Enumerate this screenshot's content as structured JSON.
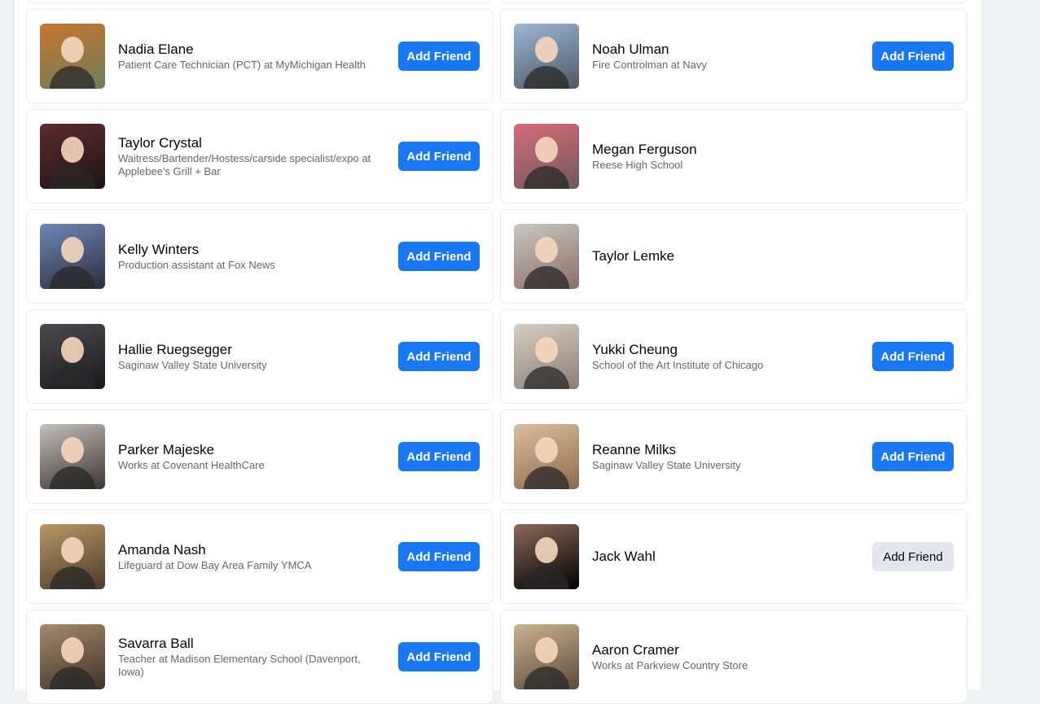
{
  "colors": {
    "primary_button": "#1877f2",
    "secondary_button": "#e4e6eb",
    "page_bg": "#f0f2f5"
  },
  "cards": [
    {
      "name": "",
      "subtitle": "",
      "button": "",
      "photo": [
        "#c9a38a",
        "#7a5a48"
      ]
    },
    {
      "name": "",
      "subtitle": "",
      "button": "",
      "photo": [
        "#b8c2c8",
        "#6b7377"
      ]
    },
    {
      "name": "Nadia Elane",
      "subtitle": "Patient Care Technician (PCT) at MyMichigan Health",
      "button": "Add Friend",
      "photo": [
        "#c9752e",
        "#6d7d5a"
      ]
    },
    {
      "name": "Noah Ulman",
      "subtitle": "Fire Controlman at Navy",
      "button": "Add Friend",
      "photo": [
        "#9bb8d6",
        "#4d5963"
      ]
    },
    {
      "name": "Taylor Crystal",
      "subtitle": "Waitress/Bartender/Hostess/carside specialist/expo at Applebee's Grill + Bar",
      "button": "Add Friend",
      "photo": [
        "#5e2b2e",
        "#1d1414"
      ]
    },
    {
      "name": "Megan Ferguson",
      "subtitle": "Reese High School",
      "button": "",
      "photo": [
        "#d86b7a",
        "#6e5a5a"
      ]
    },
    {
      "name": "Kelly Winters",
      "subtitle": "Production assistant at Fox News",
      "button": "Add Friend",
      "photo": [
        "#6f88b8",
        "#2b2d3a"
      ]
    },
    {
      "name": "Taylor Lemke",
      "subtitle": "",
      "button": "",
      "photo": [
        "#c8c8c2",
        "#8a6e64"
      ]
    },
    {
      "name": "Hallie Ruegsegger",
      "subtitle": "Saginaw Valley State University",
      "button": "Add Friend",
      "photo": [
        "#4b4a4e",
        "#1a1a1c"
      ]
    },
    {
      "name": "Yukki Cheung",
      "subtitle": "School of the Art Institute of Chicago",
      "button": "Add Friend",
      "photo": [
        "#d6cfc4",
        "#8b7e74"
      ]
    },
    {
      "name": "Parker Majeske",
      "subtitle": "Works at Covenant HealthCare",
      "button": "Add Friend",
      "photo": [
        "#c4c0bb",
        "#3d3430"
      ]
    },
    {
      "name": "Reanne Milks",
      "subtitle": "Saginaw Valley State University",
      "button": "Add Friend",
      "photo": [
        "#d9bfa0",
        "#8f6a4c"
      ]
    },
    {
      "name": "Amanda Nash",
      "subtitle": "Lifeguard at Dow Bay Area Family YMCA",
      "button": "Add Friend",
      "photo": [
        "#b89865",
        "#4c3a2a"
      ]
    },
    {
      "name": "Jack Wahl",
      "subtitle": "",
      "button": "Add Friend",
      "button_style": "grey",
      "photo": [
        "#8a6a5a",
        "#000000"
      ]
    },
    {
      "name": "Savarra Ball",
      "subtitle": "Teacher at Madison Elementary School (Davenport, Iowa)",
      "button": "Add Friend",
      "photo": [
        "#a58a6c",
        "#3e3328"
      ]
    },
    {
      "name": "Aaron Cramer",
      "subtitle": "Works at Parkview Country Store",
      "button": "",
      "photo": [
        "#c9b48e",
        "#5b4a3a"
      ]
    }
  ]
}
